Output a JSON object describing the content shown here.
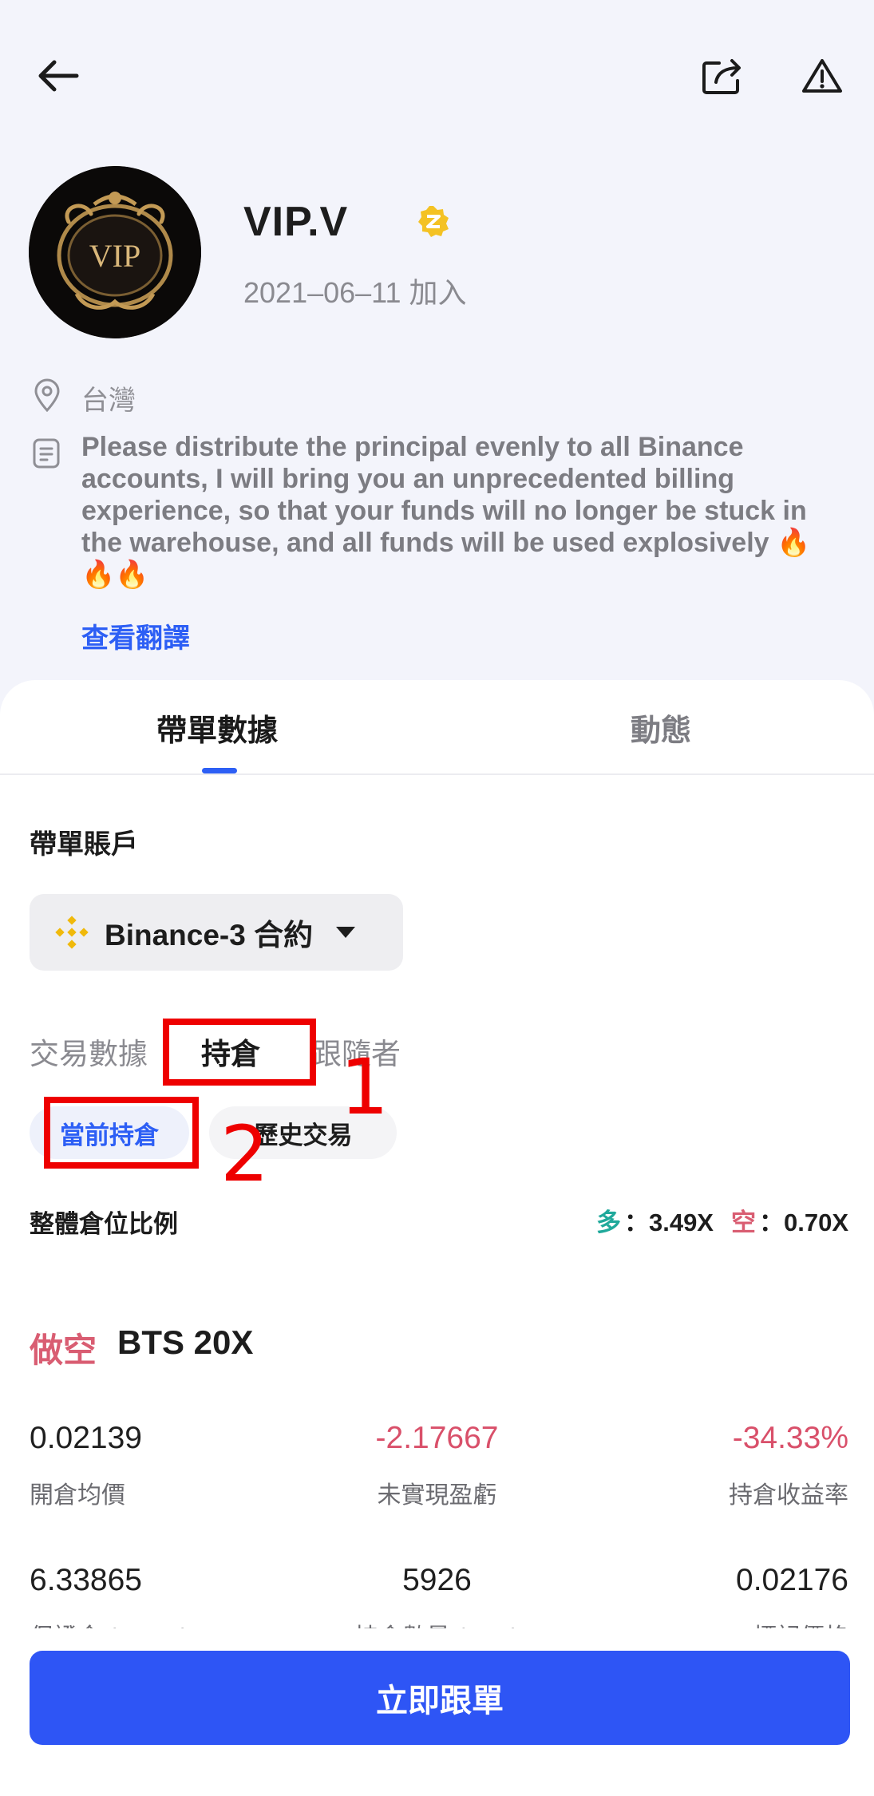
{
  "header": {
    "back_icon": "back-arrow-icon",
    "share_icon": "share-icon",
    "report_icon": "warning-icon"
  },
  "profile": {
    "avatar_text": "VIP",
    "name": "VIP.V",
    "verified_icon": "verified-badge-icon",
    "join_date": "2021–06–11 加入",
    "location": "台灣",
    "bio": "Please distribute the principal evenly to all Binance accounts, I will bring you an unprecedented billing experience, so that your funds will no longer be stuck in the warehouse, and all funds will be used explosively 🔥🔥🔥",
    "translate_label": "查看翻譯"
  },
  "tabs": {
    "active": "帶單數據",
    "inactive": "動態"
  },
  "account": {
    "section_label": "帶單賬戶",
    "selected": "Binance-3 合約"
  },
  "subtabs": {
    "trade_data": "交易數據",
    "positions": "持倉",
    "followers": "跟隨者"
  },
  "pills": {
    "current": "當前持倉",
    "history": "歷史交易"
  },
  "annotations": {
    "one": "1",
    "two": "2"
  },
  "ratio": {
    "label": "整體倉位比例",
    "long_label": "多",
    "long_value": "：3.49X",
    "short_label": "空",
    "short_value": "：0.70X"
  },
  "position": {
    "side": "做空",
    "symbol": "BTS 20X",
    "row1": {
      "open_price": "0.02139",
      "open_price_label": "開倉均價",
      "unrealized_pnl": "-2.17667",
      "unrealized_pnl_label": "未實現盈虧",
      "roi": "-34.33%",
      "roi_label": "持倉收益率"
    },
    "row2": {
      "margin": "6.33865",
      "margin_label": "保證金 (USDT)",
      "size": "5926",
      "size_label": "持倉數量 (BTS)",
      "mark_price": "0.02176",
      "mark_price_label": "標記價格"
    }
  },
  "footer": {
    "follow_button": "立即跟單"
  },
  "colors": {
    "accent": "#2d5ff5",
    "button": "#2e55f5",
    "long": "#20a99b",
    "short": "#d95d72",
    "annotation": "#ee0000"
  }
}
